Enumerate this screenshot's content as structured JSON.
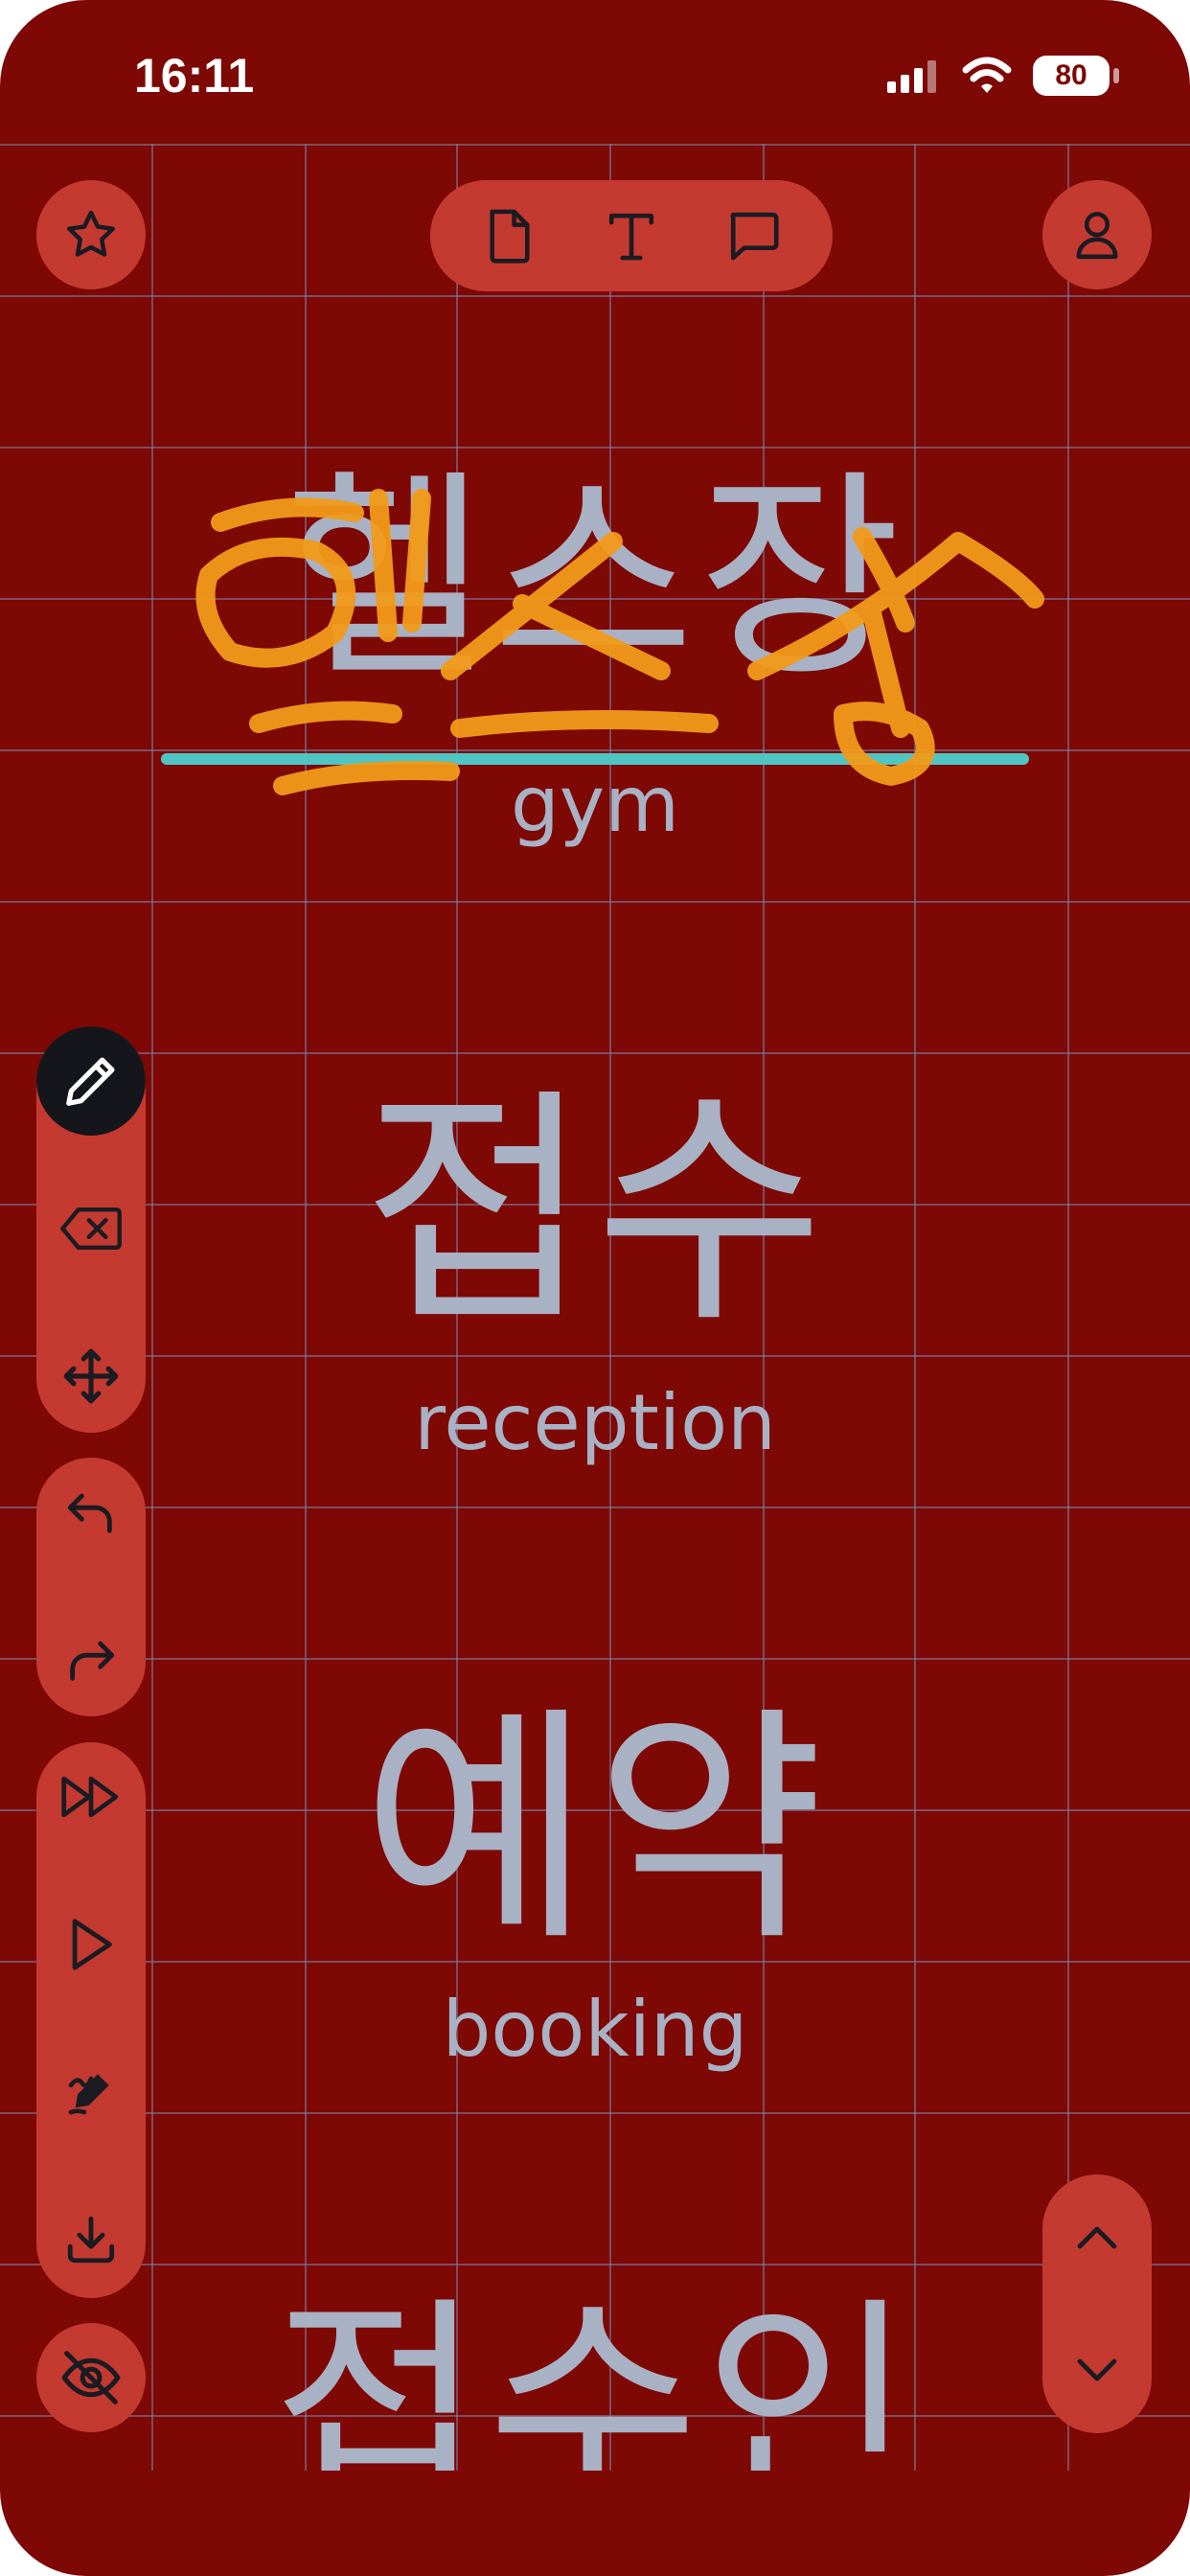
{
  "status_bar": {
    "time": "16:11",
    "battery": "80",
    "icons": [
      "signal-icon",
      "wifi-icon",
      "battery-icon"
    ]
  },
  "toolbar_top": {
    "left_button": "star-icon",
    "center_buttons": [
      "document-icon",
      "text-icon",
      "comment-icon"
    ],
    "right_button": "user-icon"
  },
  "side_tools": {
    "group_1": [
      "pencil-icon",
      "eraser-icon",
      "move-icon"
    ],
    "group_2": [
      "undo-icon",
      "redo-icon"
    ],
    "group_3": [
      "fast-forward-icon",
      "play-icon",
      "auto-write-icon",
      "download-icon"
    ],
    "bottom": "hide-icon",
    "active_tool": "pencil-icon"
  },
  "scroll": [
    "chevron-up-icon",
    "chevron-down-icon"
  ],
  "words": [
    {
      "korean": "헬스장",
      "english": "gym"
    },
    {
      "korean": "접수",
      "english": "reception"
    },
    {
      "korean": "예약",
      "english": "booking"
    },
    {
      "korean": "접수인",
      "english": ""
    }
  ],
  "colors": {
    "background": "#7d0804",
    "button": "#c43a31",
    "active_tool": "#15161c",
    "text": "#a9b1c4",
    "stroke": "#f29a1a",
    "underline": "#4fc6c4"
  }
}
